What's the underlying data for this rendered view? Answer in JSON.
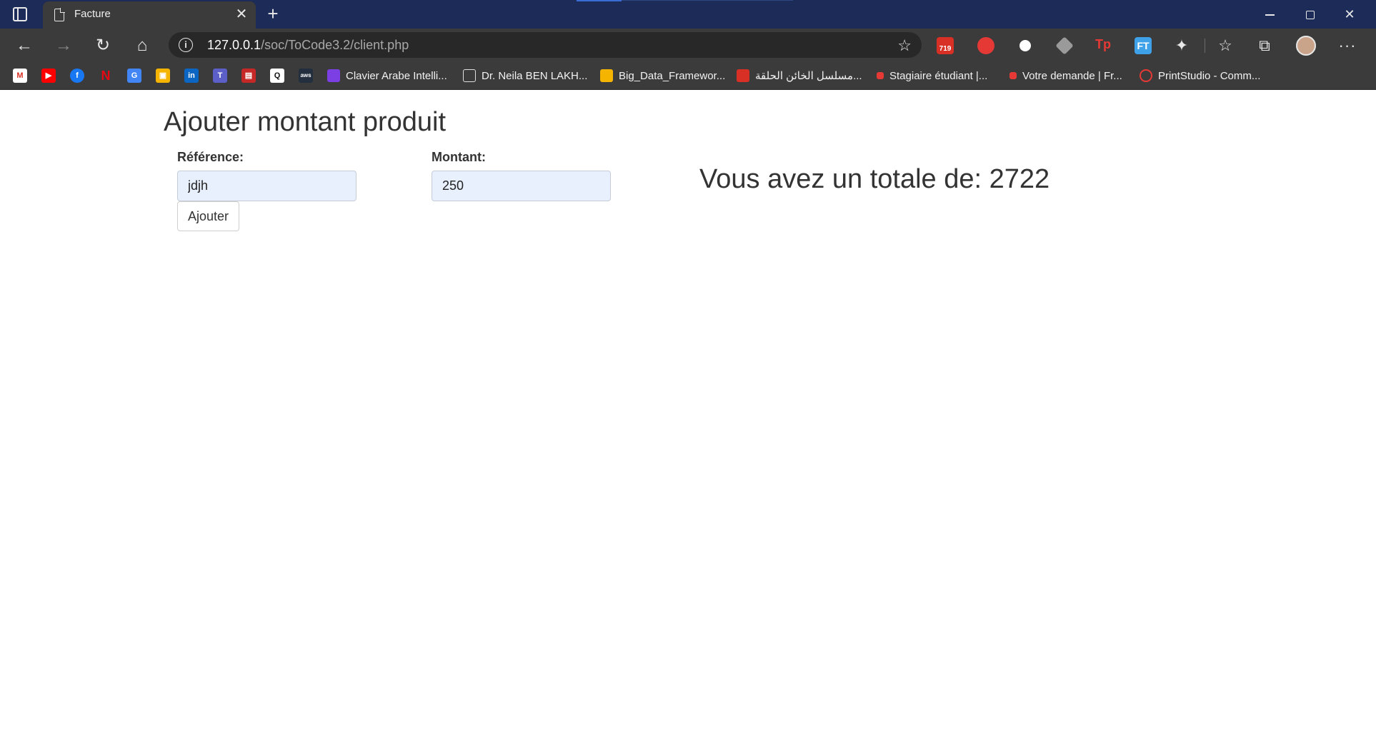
{
  "browser": {
    "tab_title": "Facture",
    "url_host": "127.0.0.1",
    "url_path": "/soc/ToCode3.2/client.php",
    "mail_badge": "719",
    "ext_tp": "Tp",
    "ext_ft": "FT"
  },
  "bookmarks": [
    {
      "label": "Clavier Arabe Intelli...",
      "color": "#7b3fe4"
    },
    {
      "label": "Dr. Neila BEN LAKH...",
      "color": "#e0e0e0"
    },
    {
      "label": "Big_Data_Framewor...",
      "color": "#f4b400"
    },
    {
      "label": "مسلسل الخائن الحلقة...",
      "color": "#d93025"
    },
    {
      "label": "Stagiaire étudiant |...",
      "color": "#e53935"
    },
    {
      "label": "Votre demande | Fr...",
      "color": "#e53935"
    },
    {
      "label": "PrintStudio - Comm...",
      "color": "#e53935"
    }
  ],
  "page": {
    "title": "Ajouter montant produit",
    "reference_label": "Référence:",
    "reference_value": "jdjh",
    "montant_label": "Montant:",
    "montant_value": "250",
    "add_button": "Ajouter",
    "total_text": "Vous avez un totale de: 2722"
  }
}
